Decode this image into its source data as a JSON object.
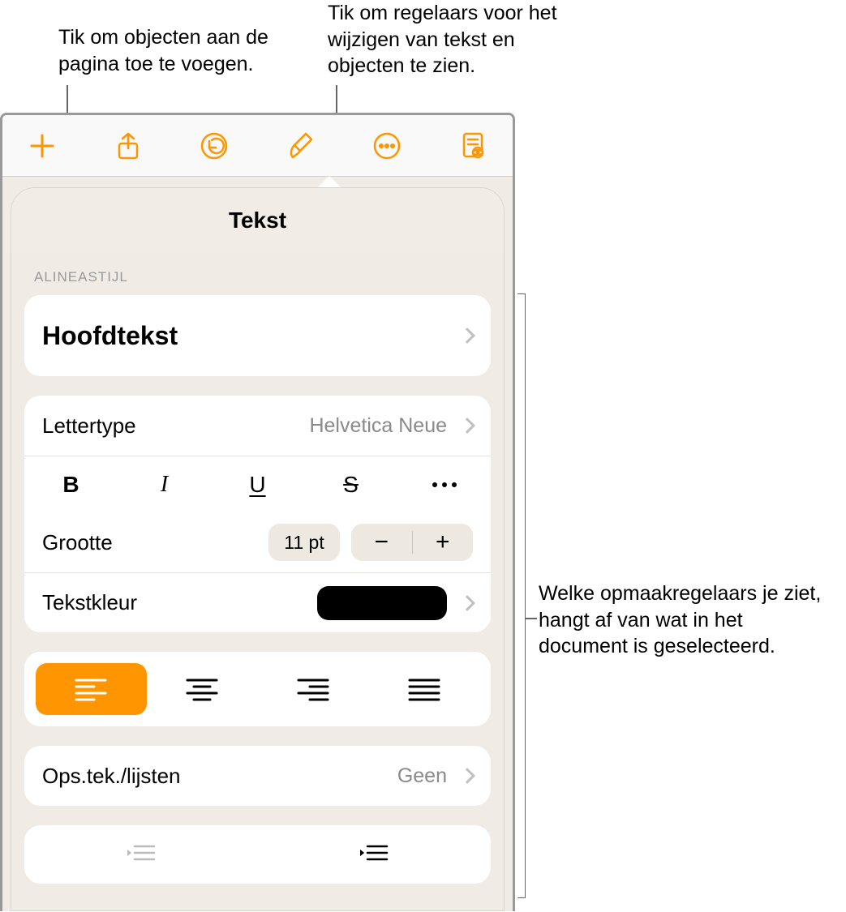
{
  "callouts": {
    "add": "Tik om objecten aan de pagina toe te voegen.",
    "format": "Tik om regelaars voor het wijzigen van tekst en objecten te zien.",
    "controls": "Welke opmaakregelaars je ziet, hangt af van wat in het document is geselecteerd."
  },
  "panel": {
    "title": "Tekst",
    "section_label": "ALINEASTIJL",
    "paragraph_style": "Hoofdtekst",
    "font": {
      "label": "Lettertype",
      "value": "Helvetica Neue"
    },
    "style_buttons": {
      "bold": "B",
      "italic": "I",
      "underline": "U",
      "strike": "S"
    },
    "size": {
      "label": "Grootte",
      "value": "11 pt",
      "minus": "−",
      "plus": "+"
    },
    "textcolor": {
      "label": "Tekstkleur",
      "value": "#000000"
    },
    "alignment": {
      "selected": "left"
    },
    "bullets": {
      "label": "Ops.tek./lijsten",
      "value": "Geen"
    }
  },
  "colors": {
    "accent": "#ff9500"
  }
}
